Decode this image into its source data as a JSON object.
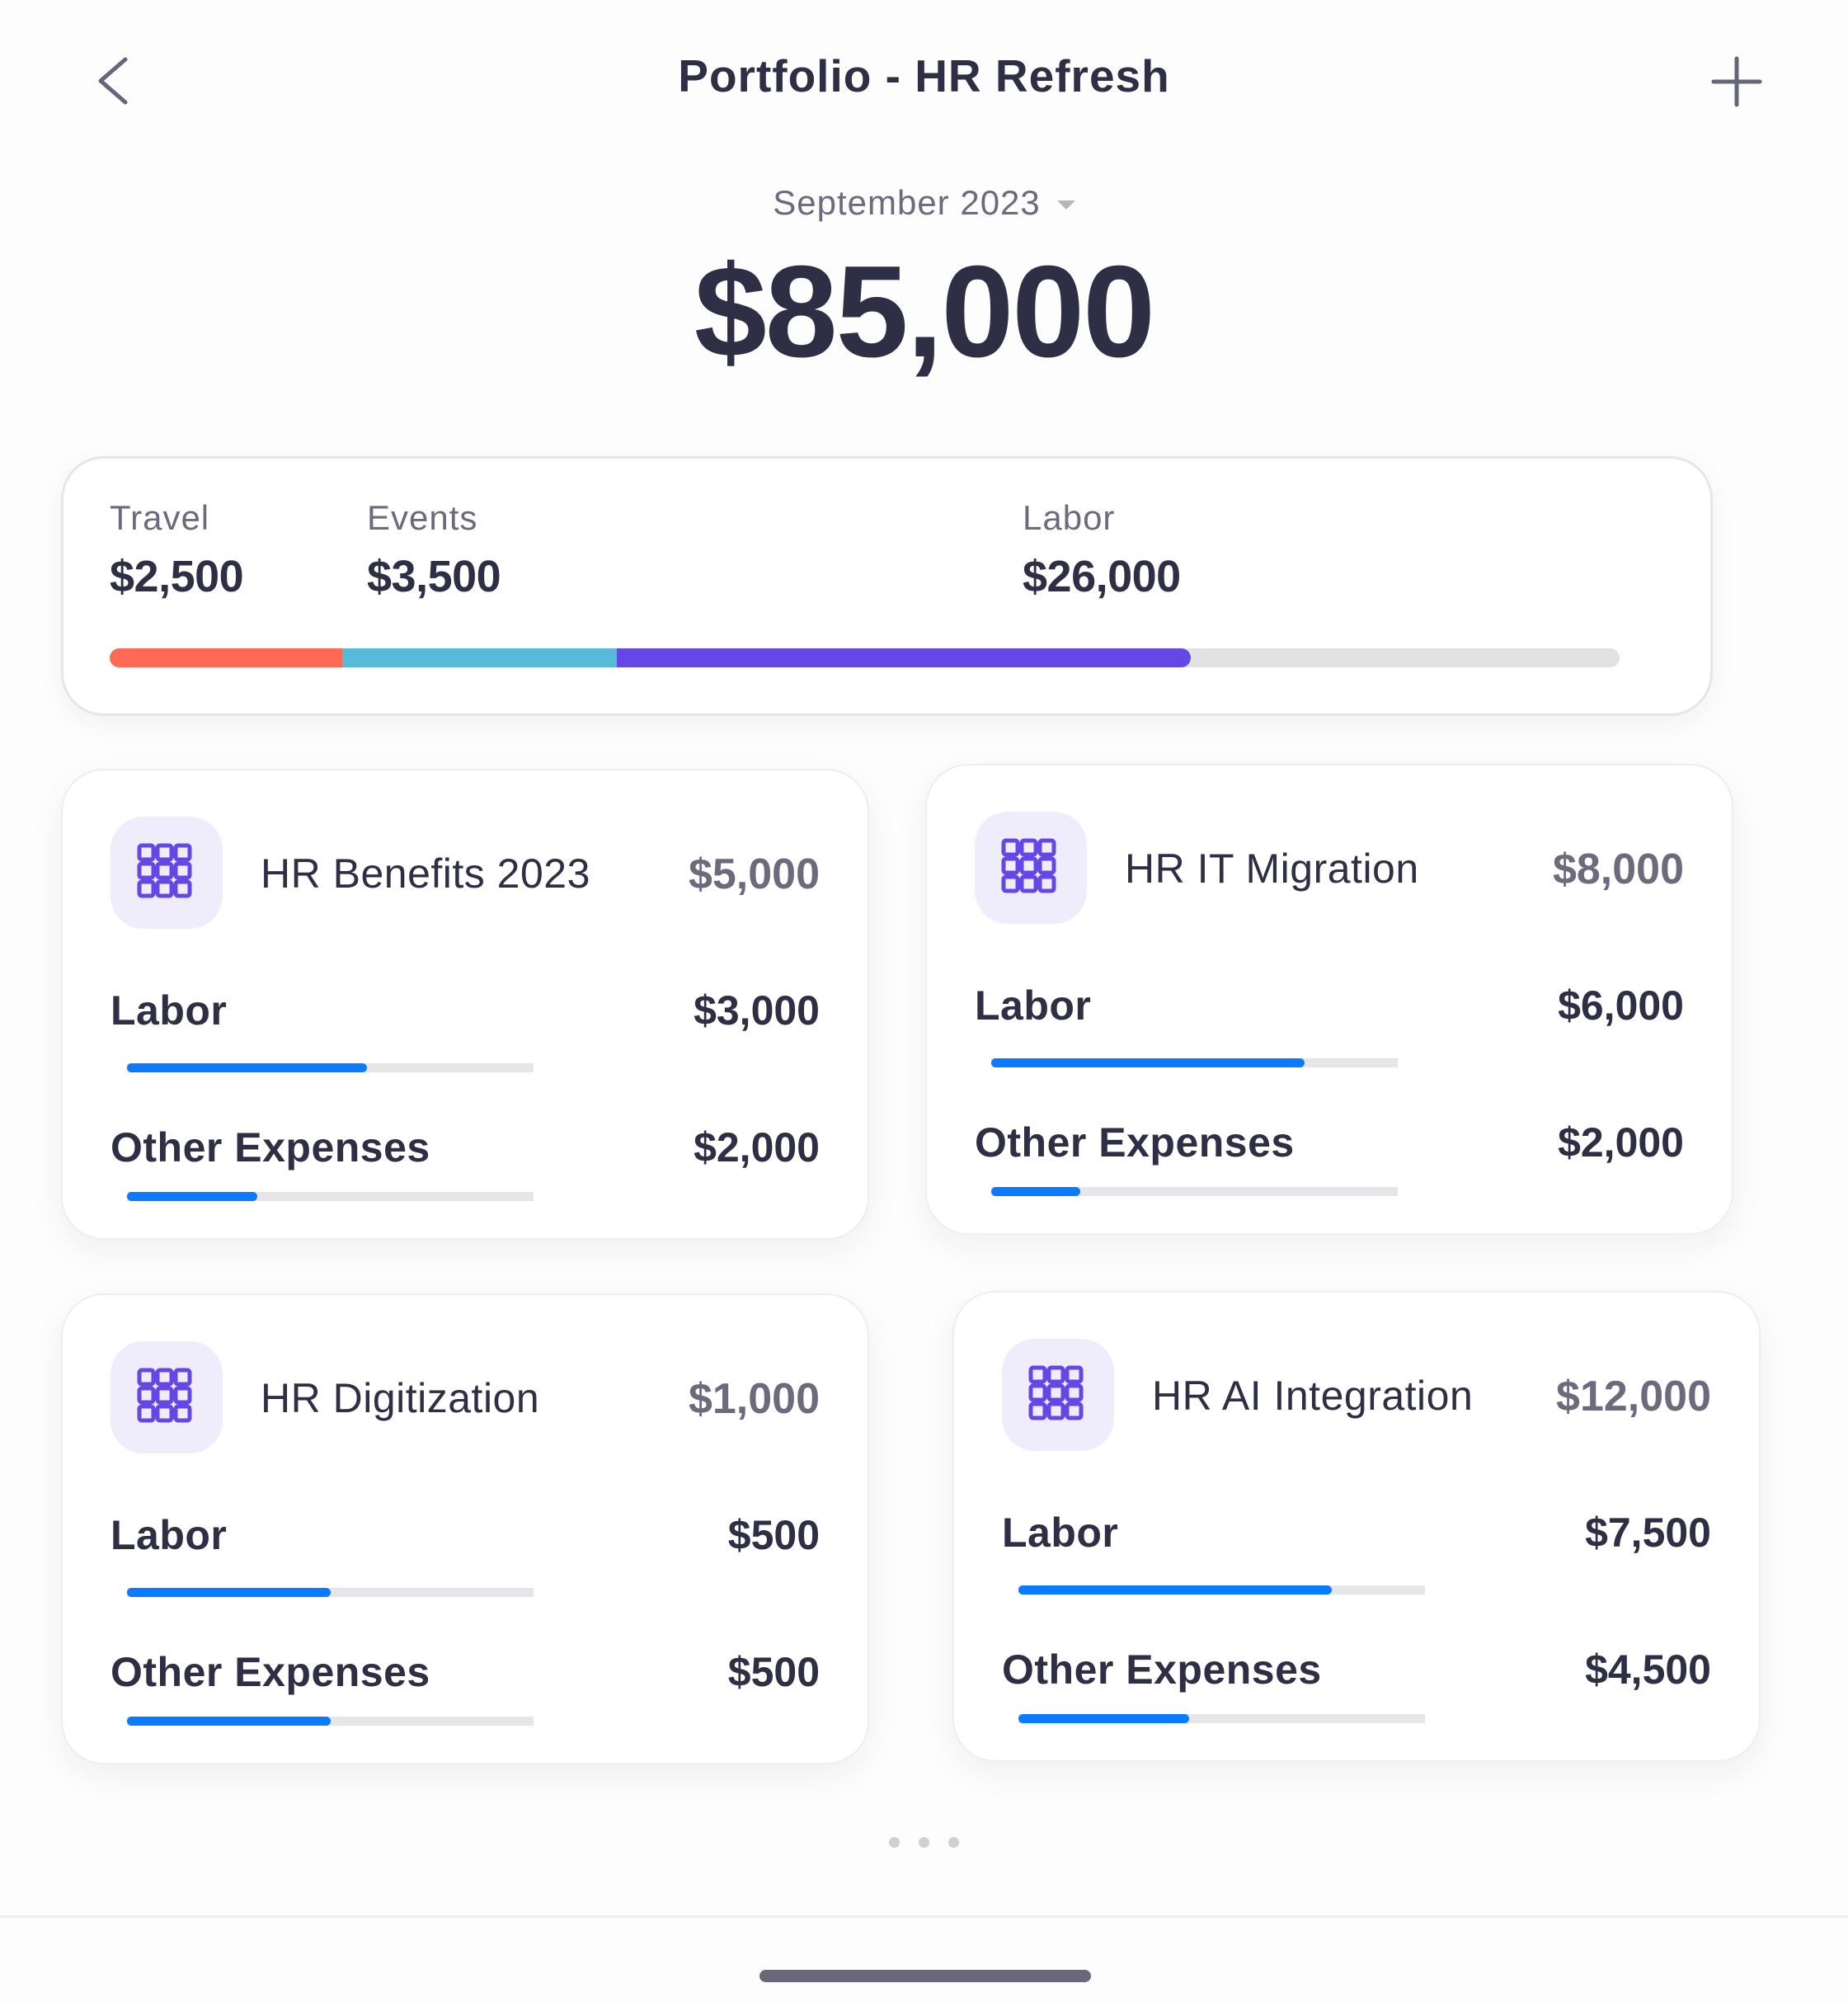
{
  "header": {
    "title": "Portfolio - HR Refresh",
    "back_icon": "chevron-left-icon",
    "add_icon": "plus-icon"
  },
  "period": {
    "label": "September 2023",
    "caret_icon": "caret-down-icon"
  },
  "total": {
    "amount": "$85,000"
  },
  "summary": {
    "categories": [
      {
        "label": "Travel",
        "value": "$2,500",
        "color": "#FF6A55",
        "bar_fraction": 0.154
      },
      {
        "label": "Events",
        "value": "$3,500",
        "color": "#58B9D8",
        "bar_fraction": 0.182
      },
      {
        "label": "Labor",
        "value": "$26,000",
        "color": "#6547E6",
        "bar_fraction": 0.38
      }
    ],
    "track_color": "#E2E2E5"
  },
  "projects": [
    {
      "icon": "grid-icon",
      "title": "HR Benefits 2023",
      "total": "$5,000",
      "lines": [
        {
          "label": "Labor",
          "value": "$3,000",
          "progress": 0.59
        },
        {
          "label": "Other Expenses",
          "value": "$2,000",
          "progress": 0.32
        }
      ]
    },
    {
      "icon": "grid-icon",
      "title": "HR IT Migration",
      "total": "$8,000",
      "lines": [
        {
          "label": "Labor",
          "value": "$6,000",
          "progress": 0.77
        },
        {
          "label": "Other Expenses",
          "value": "$2,000",
          "progress": 0.22
        }
      ]
    },
    {
      "icon": "grid-icon",
      "title": "HR Digitization",
      "total": "$1,000",
      "lines": [
        {
          "label": "Labor",
          "value": "$500",
          "progress": 0.5
        },
        {
          "label": "Other Expenses",
          "value": "$500",
          "progress": 0.5
        }
      ]
    },
    {
      "icon": "grid-icon",
      "title": "HR AI Integration",
      "total": "$12,000",
      "lines": [
        {
          "label": "Labor",
          "value": "$7,500",
          "progress": 0.77
        },
        {
          "label": "Other Expenses",
          "value": "$4,500",
          "progress": 0.42
        }
      ]
    }
  ],
  "colors": {
    "accent_purple": "#6547E6",
    "progress_blue": "#0A7AFF",
    "text_dark": "#2E2E45",
    "text_muted": "#6B6B7D",
    "icon_bg": "#EFECFB"
  },
  "pager": {
    "page_count": 3
  }
}
